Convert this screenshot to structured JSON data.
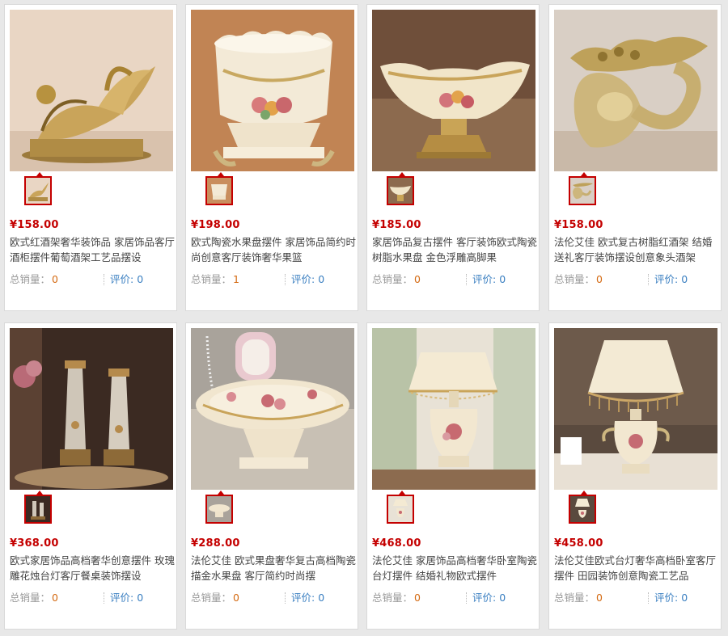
{
  "products": [
    {
      "price": "¥158.00",
      "title": "欧式红酒架奢华装饰品 家居饰品客厅酒柜摆件葡萄酒架工艺品摆设",
      "sales_label": "总销量：",
      "sales": "0",
      "review_label": "评价:",
      "reviews": "0",
      "image": "gold-cornucopia-wine-rack"
    },
    {
      "price": "¥198.00",
      "title": "欧式陶瓷水果盘摆件 家居饰品简约时尚创意客厅装饰奢华果篮",
      "sales_label": "总销量：",
      "sales": "1",
      "review_label": "评价:",
      "reviews": "0",
      "image": "ceramic-fruit-bowl"
    },
    {
      "price": "¥185.00",
      "title": "家居饰品复古摆件 客厅装饰欧式陶瓷树脂水果盘 金色浮雕高脚果",
      "sales_label": "总销量：",
      "sales": "0",
      "review_label": "评价:",
      "reviews": "0",
      "image": "pedestal-fruit-dish"
    },
    {
      "price": "¥158.00",
      "title": "法伦艾佳 欧式复古树脂红酒架 结婚送礼客厅装饰摆设创意象头酒架",
      "sales_label": "总销量：",
      "sales": "0",
      "review_label": "评价:",
      "reviews": "0",
      "image": "elephant-wine-rack"
    },
    {
      "price": "¥368.00",
      "title": "欧式家居饰品高档奢华创意摆件 玫瑰雕花烛台灯客厅餐桌装饰摆设",
      "sales_label": "总销量：",
      "sales": "0",
      "review_label": "评价:",
      "reviews": "0",
      "image": "candle-holders"
    },
    {
      "price": "¥288.00",
      "title": "法伦艾佳 欧式果盘奢华复古高档陶瓷描金水果盘 客厅简约时尚摆",
      "sales_label": "总销量：",
      "sales": "0",
      "review_label": "评价:",
      "reviews": "0",
      "image": "rose-fruit-plate"
    },
    {
      "price": "¥468.00",
      "title": "法伦艾佳 家居饰品高档奢华卧室陶瓷台灯摆件 结婚礼物欧式摆件",
      "sales_label": "总销量：",
      "sales": "0",
      "review_label": "评价:",
      "reviews": "0",
      "image": "ceramic-table-lamp"
    },
    {
      "price": "¥458.00",
      "title": "法伦艾佳欧式台灯奢华高档卧室客厅摆件 田园装饰创意陶瓷工艺品",
      "sales_label": "总销量：",
      "sales": "0",
      "review_label": "评价:",
      "reviews": "0",
      "image": "beaded-table-lamp"
    }
  ],
  "colors": {
    "price": "#c40000",
    "sales_value": "#d46a12",
    "review": "#3a7fc1",
    "thumb_border": "#c40000"
  }
}
